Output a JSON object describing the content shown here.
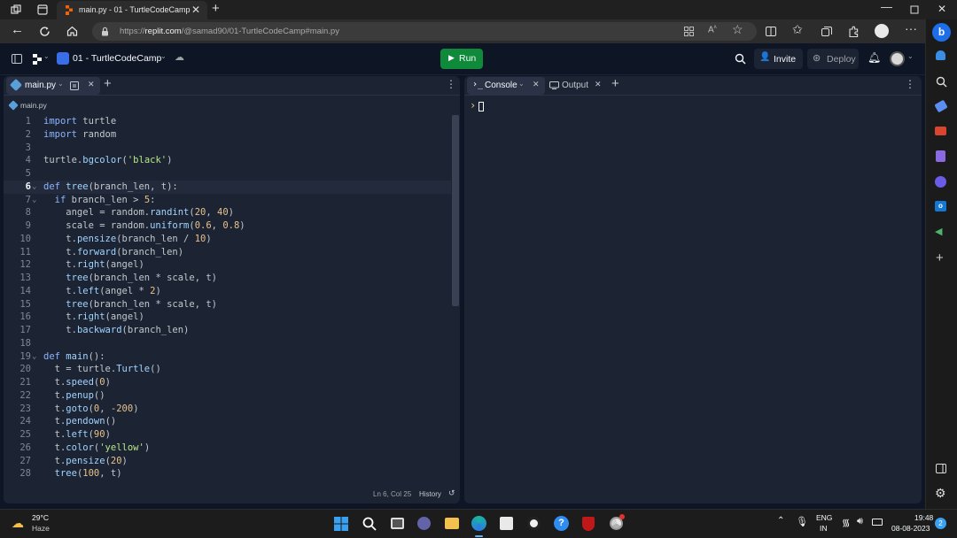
{
  "browser": {
    "tab_title": "main.py - 01 - TurtleCodeCamp",
    "url_prefix": "https://",
    "url_host": "replit.com",
    "url_path": "/@samad90/01-TurtleCodeCamp#main.py"
  },
  "replit": {
    "repl_name": "01 - TurtleCodeCamp",
    "run_label": "Run",
    "invite_label": "Invite",
    "deploy_label": "Deploy",
    "accent_run": "#0f8a3a"
  },
  "editor": {
    "tab_label": "main.py",
    "breadcrumb": "main.py",
    "status_position": "Ln 6, Col 25",
    "history_label": "History",
    "lines": [
      {
        "n": "1",
        "fold": "",
        "t": [
          [
            "kw",
            "import"
          ],
          [
            "",
            " turtle"
          ]
        ]
      },
      {
        "n": "2",
        "fold": "",
        "t": [
          [
            "kw",
            "import"
          ],
          [
            "",
            " random"
          ]
        ]
      },
      {
        "n": "3",
        "fold": "",
        "t": []
      },
      {
        "n": "4",
        "fold": "",
        "t": [
          [
            "",
            "turtle."
          ],
          [
            "fn",
            "bgcolor"
          ],
          [
            "",
            "("
          ],
          [
            "str",
            "'black'"
          ],
          [
            "",
            ")"
          ]
        ]
      },
      {
        "n": "5",
        "fold": "",
        "t": []
      },
      {
        "n": "6",
        "fold": "⌄",
        "cur": true,
        "t": [
          [
            "kw",
            "def"
          ],
          [
            "",
            " "
          ],
          [
            "fn",
            "tree"
          ],
          [
            "",
            "(branch_len, t):"
          ]
        ]
      },
      {
        "n": "7",
        "fold": "⌄",
        "t": [
          [
            "",
            "  "
          ],
          [
            "kw",
            "if"
          ],
          [
            "",
            " branch_len > "
          ],
          [
            "num",
            "5"
          ],
          [
            "",
            ":"
          ]
        ]
      },
      {
        "n": "8",
        "fold": "",
        "t": [
          [
            "",
            "    angel = random."
          ],
          [
            "fn",
            "randint"
          ],
          [
            "",
            "("
          ],
          [
            "num",
            "20"
          ],
          [
            "",
            ", "
          ],
          [
            "num",
            "40"
          ],
          [
            "",
            ")"
          ]
        ]
      },
      {
        "n": "9",
        "fold": "",
        "t": [
          [
            "",
            "    scale = random."
          ],
          [
            "fn",
            "uniform"
          ],
          [
            "",
            "("
          ],
          [
            "num",
            "0.6"
          ],
          [
            "",
            ", "
          ],
          [
            "num",
            "0.8"
          ],
          [
            "",
            ")"
          ]
        ]
      },
      {
        "n": "10",
        "fold": "",
        "t": [
          [
            "",
            "    t."
          ],
          [
            "fn",
            "pensize"
          ],
          [
            "",
            "(branch_len / "
          ],
          [
            "num",
            "10"
          ],
          [
            "",
            ")"
          ]
        ]
      },
      {
        "n": "11",
        "fold": "",
        "t": [
          [
            "",
            "    t."
          ],
          [
            "fn",
            "forward"
          ],
          [
            "",
            "(branch_len)"
          ]
        ]
      },
      {
        "n": "12",
        "fold": "",
        "t": [
          [
            "",
            "    t."
          ],
          [
            "fn",
            "right"
          ],
          [
            "",
            "(angel)"
          ]
        ]
      },
      {
        "n": "13",
        "fold": "",
        "t": [
          [
            "",
            "    "
          ],
          [
            "fn",
            "tree"
          ],
          [
            "",
            "(branch_len * scale, t)"
          ]
        ]
      },
      {
        "n": "14",
        "fold": "",
        "t": [
          [
            "",
            "    t."
          ],
          [
            "fn",
            "left"
          ],
          [
            "",
            "(angel * "
          ],
          [
            "num",
            "2"
          ],
          [
            "",
            ")"
          ]
        ]
      },
      {
        "n": "15",
        "fold": "",
        "t": [
          [
            "",
            "    "
          ],
          [
            "fn",
            "tree"
          ],
          [
            "",
            "(branch_len * scale, t)"
          ]
        ]
      },
      {
        "n": "16",
        "fold": "",
        "t": [
          [
            "",
            "    t."
          ],
          [
            "fn",
            "right"
          ],
          [
            "",
            "(angel)"
          ]
        ]
      },
      {
        "n": "17",
        "fold": "",
        "t": [
          [
            "",
            "    t."
          ],
          [
            "fn",
            "backward"
          ],
          [
            "",
            "(branch_len)"
          ]
        ]
      },
      {
        "n": "18",
        "fold": "",
        "t": []
      },
      {
        "n": "19",
        "fold": "⌄",
        "t": [
          [
            "kw",
            "def"
          ],
          [
            "",
            " "
          ],
          [
            "fn",
            "main"
          ],
          [
            "",
            "():"
          ]
        ]
      },
      {
        "n": "20",
        "fold": "",
        "t": [
          [
            "",
            "  t = turtle."
          ],
          [
            "fn",
            "Turtle"
          ],
          [
            "",
            "()"
          ]
        ]
      },
      {
        "n": "21",
        "fold": "",
        "t": [
          [
            "",
            "  t."
          ],
          [
            "fn",
            "speed"
          ],
          [
            "",
            "("
          ],
          [
            "num",
            "0"
          ],
          [
            "",
            ")"
          ]
        ]
      },
      {
        "n": "22",
        "fold": "",
        "t": [
          [
            "",
            "  t."
          ],
          [
            "fn",
            "penup"
          ],
          [
            "",
            "()"
          ]
        ]
      },
      {
        "n": "23",
        "fold": "",
        "t": [
          [
            "",
            "  t."
          ],
          [
            "fn",
            "goto"
          ],
          [
            "",
            "("
          ],
          [
            "num",
            "0"
          ],
          [
            "",
            ", "
          ],
          [
            "num",
            "-200"
          ],
          [
            "",
            ")"
          ]
        ]
      },
      {
        "n": "24",
        "fold": "",
        "t": [
          [
            "",
            "  t."
          ],
          [
            "fn",
            "pendown"
          ],
          [
            "",
            "()"
          ]
        ]
      },
      {
        "n": "25",
        "fold": "",
        "t": [
          [
            "",
            "  t."
          ],
          [
            "fn",
            "left"
          ],
          [
            "",
            "("
          ],
          [
            "num",
            "90"
          ],
          [
            "",
            ")"
          ]
        ]
      },
      {
        "n": "26",
        "fold": "",
        "t": [
          [
            "",
            "  t."
          ],
          [
            "fn",
            "color"
          ],
          [
            "",
            "("
          ],
          [
            "str",
            "'yellow'"
          ],
          [
            "",
            ")"
          ]
        ]
      },
      {
        "n": "27",
        "fold": "",
        "t": [
          [
            "",
            "  t."
          ],
          [
            "fn",
            "pensize"
          ],
          [
            "",
            "("
          ],
          [
            "num",
            "20"
          ],
          [
            "",
            ")"
          ]
        ]
      },
      {
        "n": "28",
        "fold": "",
        "t": [
          [
            "",
            "  "
          ],
          [
            "fn",
            "tree"
          ],
          [
            "",
            "("
          ],
          [
            "num",
            "100"
          ],
          [
            "",
            ", t)"
          ]
        ]
      }
    ]
  },
  "console": {
    "tab_console": "Console",
    "tab_output": "Output",
    "prompt": "›"
  },
  "taskbar": {
    "weather_temp": "29°C",
    "weather_desc": "Haze",
    "lang_top": "ENG",
    "lang_bottom": "IN",
    "time": "19:48",
    "date": "08-08-2023",
    "notif_count": "2"
  }
}
